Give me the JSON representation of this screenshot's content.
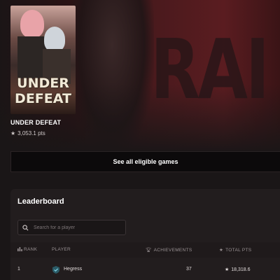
{
  "game": {
    "cover_logo_line1": "UNDER",
    "cover_logo_line2": "DEFEAT",
    "title": "UNDER DEFEAT",
    "points": "3,053.1 pts"
  },
  "banner_text": "RAI",
  "eligible_button_label": "See all eligible games",
  "leaderboard": {
    "title": "Leaderboard",
    "search_placeholder": "Search for a player",
    "columns": {
      "rank": "RANK",
      "player": "PLAYER",
      "achievements": "ACHIEVEMENTS",
      "total_pts": "TOTAL PTS"
    },
    "rows": [
      {
        "rank": "1",
        "player": "Hegress",
        "achievements": "37",
        "total_pts": "18,318.6"
      }
    ]
  },
  "colors": {
    "accent_red": "#5a1c20",
    "background": "#1a1617",
    "badge_teal": "#4fb3c8"
  }
}
